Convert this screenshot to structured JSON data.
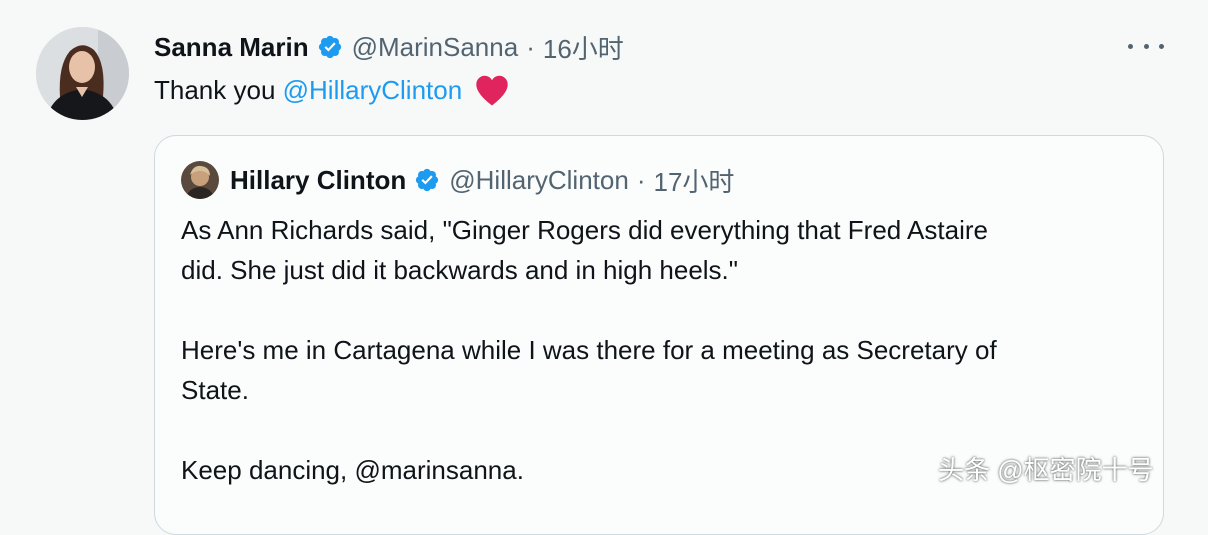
{
  "tweet": {
    "author_name": "Sanna Marin",
    "handle": "@MarinSanna",
    "separator": "·",
    "time": "16小时",
    "text_before": "Thank you ",
    "mention": "@HillaryClinton",
    "heart_icon": "red-heart",
    "verified_icon": "verified-badge",
    "more_icon": "more-horizontal"
  },
  "quote": {
    "author_name": "Hillary Clinton",
    "handle": "@HillaryClinton",
    "separator": "·",
    "time": "17小时",
    "line1": "As Ann Richards said, \"Ginger Rogers did everything that Fred Astaire",
    "line2": "did. She just did it backwards and in high heels.\"",
    "line3": "Here's me in Cartagena while I was there for a meeting as Secretary of",
    "line4": "State.",
    "line5_text": "Keep dancing, ",
    "line5_mention": "@marinsanna",
    "line5_end": "."
  },
  "watermark": "头条 @枢密院十号",
  "colors": {
    "link": "#1d9bf0",
    "verified": "#1d9bf0",
    "secondary_text": "#536471",
    "heart": "#e0245e"
  }
}
